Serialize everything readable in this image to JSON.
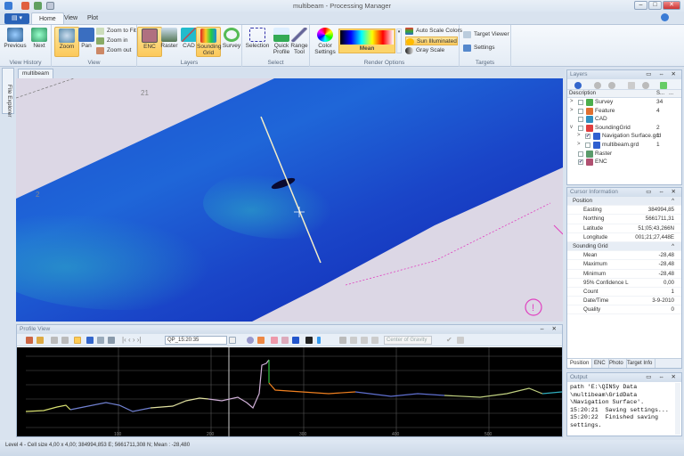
{
  "window": {
    "title": "multibeam - Processing Manager",
    "min": "–",
    "max": "□",
    "close": "✕"
  },
  "ribbon_tabs": [
    {
      "label": "Home",
      "active": true
    },
    {
      "label": "View"
    },
    {
      "label": "Plot"
    }
  ],
  "app_menu": "▤ ▾",
  "groups": {
    "view_history": {
      "label": "View History",
      "previous": "Previous",
      "next": "Next"
    },
    "view": {
      "label": "View",
      "zoom": "Zoom",
      "pan": "Pan",
      "zoom_to_fit": "Zoom to Fit",
      "zoom_in": "Zoom in",
      "zoom_out": "Zoom out"
    },
    "layers": {
      "label": "Layers",
      "enc": "ENC",
      "raster": "Raster",
      "cad": "CAD",
      "sounding_grid": "Sounding Grid",
      "survey": "Survey"
    },
    "select": {
      "label": "Select",
      "selection": "Selection",
      "quick_profile": "Quick Profile",
      "range_tool": "Range Tool"
    },
    "render": {
      "label": "Render Options",
      "color_settings": "Color Settings",
      "palette": "Mean",
      "auto_scale": "Auto Scale Colors",
      "sun": "Sun Illuminated",
      "gray": "Gray Scale"
    },
    "targets": {
      "label": "Targets",
      "viewer": "Target Viewer",
      "settings": "Settings"
    }
  },
  "document_tab": "multibeam",
  "file_explorer": "File Explorer",
  "map": {
    "labels": [
      "21",
      "21",
      "2"
    ]
  },
  "profile": {
    "title": "Profile View",
    "profile_name": "QP_15:20:35",
    "method": "Center of Gravity",
    "x_ticks": [
      "100",
      "200",
      "300",
      "400",
      "500"
    ],
    "controls": "⇔ ✕"
  },
  "layers": {
    "title": "Layers",
    "columns": [
      "Description",
      "S...",
      "..."
    ],
    "items": [
      {
        "name": "Survey",
        "count": "34",
        "expand": ">",
        "checked": false,
        "level": 0,
        "color": "#4cae4c"
      },
      {
        "name": "Feature",
        "count": "4",
        "expand": ">",
        "checked": false,
        "level": 0,
        "color": "#e07030"
      },
      {
        "name": "CAD",
        "count": "",
        "expand": "",
        "checked": false,
        "level": 0,
        "color": "#3090c0"
      },
      {
        "name": "SoundingGrid",
        "count": "2",
        "expand": "v",
        "checked": false,
        "level": 0,
        "color": "#e04040"
      },
      {
        "name": "Navigation Surface.grd",
        "count": "1",
        "expand": ">",
        "checked": true,
        "level": 1,
        "color": "#3060d0"
      },
      {
        "name": "multibeam.grd",
        "count": "1",
        "expand": ">",
        "checked": false,
        "level": 1,
        "color": "#3060d0"
      },
      {
        "name": "Raster",
        "count": "",
        "expand": "",
        "checked": false,
        "level": 0,
        "color": "#5a9a6a"
      },
      {
        "name": "ENC",
        "count": "",
        "expand": "",
        "checked": true,
        "level": 0,
        "color": "#b05070"
      }
    ]
  },
  "cursor_info": {
    "title": "Cursor Information",
    "sections": [
      {
        "name": "Position",
        "rows": [
          [
            "Easting",
            "384994,85"
          ],
          [
            "Northing",
            "5661711,31"
          ],
          [
            "Latitude",
            "51;05;43,266N"
          ],
          [
            "Longitude",
            "001;21;27,448E"
          ]
        ]
      },
      {
        "name": "Sounding Grid",
        "rows": [
          [
            "Mean",
            "-28,48"
          ],
          [
            "Maximum",
            "-28,48"
          ],
          [
            "Minimum",
            "-28,48"
          ],
          [
            "95% Confidence L",
            "0,00"
          ],
          [
            "Count",
            "1"
          ],
          [
            "Date/Time",
            "3-9-2010"
          ],
          [
            "Quality",
            "0"
          ]
        ]
      }
    ],
    "tabs": [
      "Position",
      "ENC",
      "Photo",
      "Target Info"
    ]
  },
  "output": {
    "title": "Output",
    "text": "path 'E:\\QINSy Data\n\\multibeam\\GridData\n\\Navigation Surface'.\n15:20:21  Saving settings...\n15:20:22  Finished saving\nsettings."
  },
  "status": "Level 4 - Cell size 4,00 x 4,00; 384994,853 E; 5661711,308 N; Mean : -28,480",
  "colors": {
    "accent": "#2a63b8",
    "highlight": "#fcc95a",
    "map_bg": "#dcd7e5",
    "enc_line": "#e040c0"
  }
}
